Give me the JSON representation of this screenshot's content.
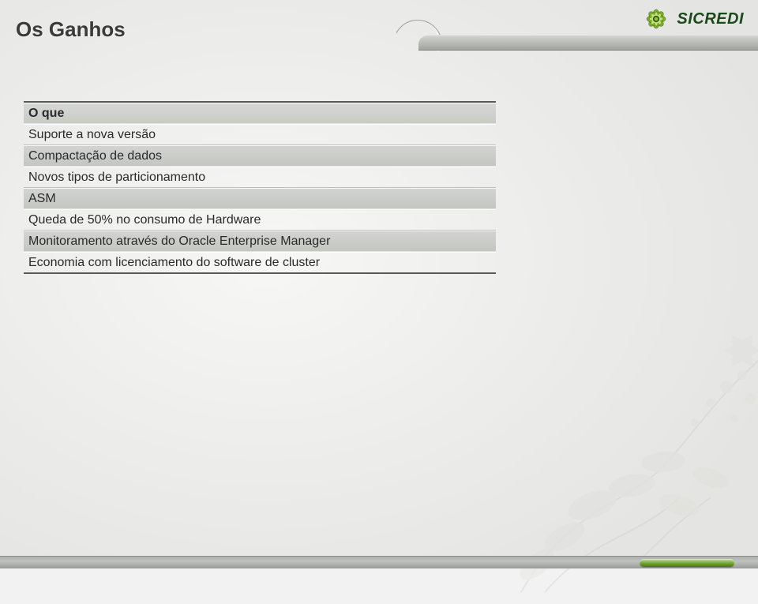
{
  "slide": {
    "title": "Os Ganhos"
  },
  "brand": {
    "name": "SICREDI"
  },
  "table": {
    "header": "O que",
    "rows": [
      "Suporte a nova versão",
      "Compactação de dados",
      "Novos tipos de particionamento",
      "ASM",
      "Queda de 50% no consumo de Hardware",
      "Monitoramento através do Oracle Enterprise Manager",
      "Economia com licenciamento do software de cluster"
    ]
  },
  "colors": {
    "accent_green": "#7aa92b",
    "dark_green": "#1a4a1a",
    "row_shade": "#cbcdc9"
  }
}
